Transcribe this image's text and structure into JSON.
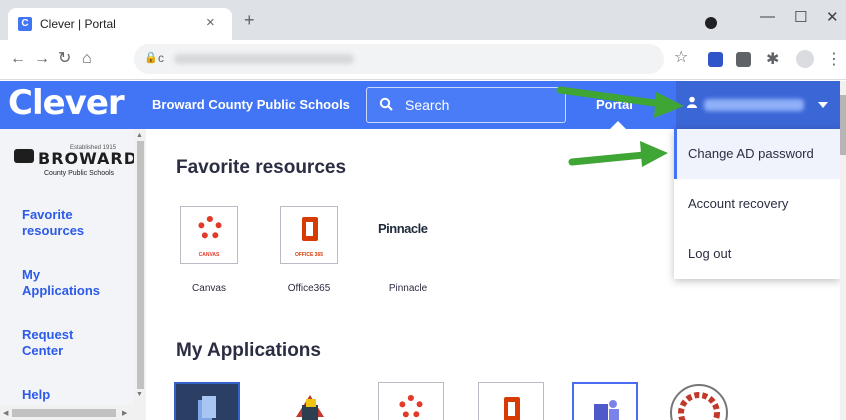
{
  "browser": {
    "tab_title": "Clever | Portal",
    "tab_close": "×",
    "new_tab": "+",
    "favicon_letter": "C",
    "url_prefix": "c",
    "window_controls": {
      "minimize": "—",
      "maximize": "☐",
      "close": "✕"
    }
  },
  "header": {
    "logo": "Clever",
    "district": "Broward County Public Schools",
    "search_label": "Search",
    "portal_label": "Portal"
  },
  "sidebar": {
    "logo_established": "Established 1915",
    "logo_name": "BROWARD",
    "logo_sub": "County Public Schools",
    "items": [
      {
        "label_line1": "Favorite",
        "label_line2": "resources"
      },
      {
        "label_line1": "My",
        "label_line2": "Applications"
      },
      {
        "label_line1": "Request",
        "label_line2": "Center"
      },
      {
        "label_line1": "Help",
        "label_line2": ""
      }
    ]
  },
  "main": {
    "favorites_title": "Favorite resources",
    "my_apps_title": "My Applications",
    "favorites": [
      {
        "name": "Canvas",
        "caption": "CANVAS"
      },
      {
        "name": "Office365",
        "caption": "OFFICE 365"
      },
      {
        "name": "Pinnacle",
        "logo_text": "Pinnacle"
      }
    ]
  },
  "dropdown": {
    "items": [
      "Change AD password",
      "Account recovery",
      "Log out"
    ]
  },
  "colors": {
    "clever_blue": "#4274f6",
    "arrow_green": "#3fa535",
    "canvas_red": "#e13a2a",
    "office_orange": "#d83b01"
  }
}
